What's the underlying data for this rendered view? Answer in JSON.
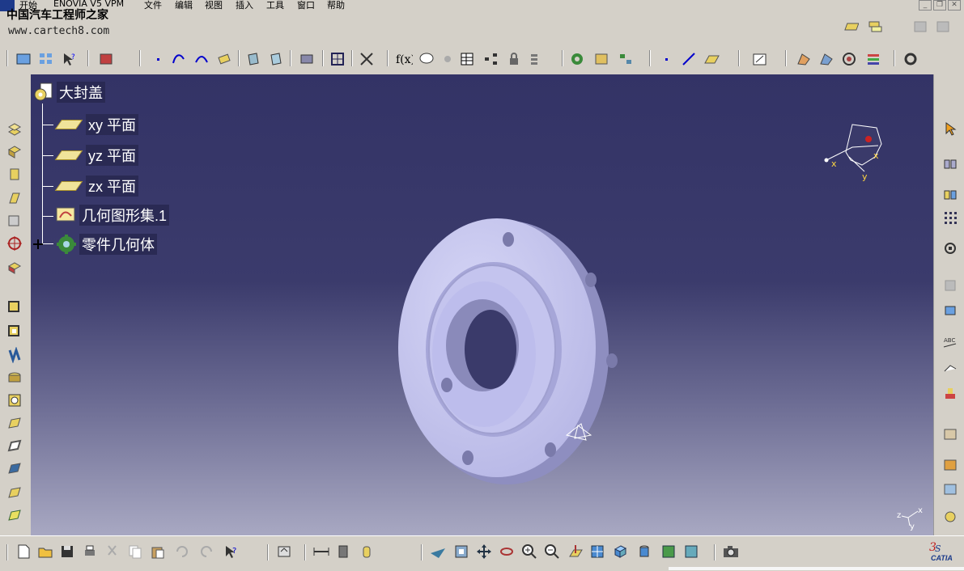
{
  "menu": {
    "items": [
      "开始",
      "ENOVIA V5 VPM",
      "文件",
      "编辑",
      "视图",
      "插入",
      "工具",
      "窗口",
      "帮助"
    ]
  },
  "watermark": {
    "title": "中国汽车工程师之家",
    "url": "www.cartech8.com"
  },
  "tree": {
    "root": "大封盖",
    "children": [
      {
        "label": "xy 平面",
        "icon": "plane-icon"
      },
      {
        "label": "yz 平面",
        "icon": "plane-icon"
      },
      {
        "label": "zx 平面",
        "icon": "plane-icon"
      },
      {
        "label": "几何图形集.1",
        "icon": "geometrical-set-icon"
      },
      {
        "label": "零件几何体",
        "icon": "part-body-icon"
      }
    ]
  },
  "compass": {
    "x": "x",
    "y": "y",
    "z": "z"
  },
  "axis_small": {
    "z": "z",
    "x": "x",
    "y": "y"
  },
  "brand": "CATIA",
  "colors": {
    "viewport_top": "#333366",
    "viewport_bottom": "#a8a8c2",
    "part_face": "#c8c8f0",
    "part_shadow": "#9a9ac8",
    "toolbar": "#d4d0c8"
  }
}
